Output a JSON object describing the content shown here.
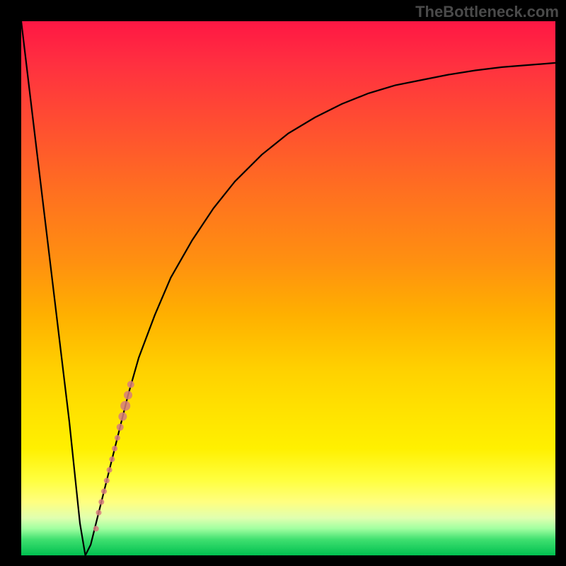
{
  "watermark": "TheBottleneck.com",
  "chart_data": {
    "type": "line",
    "title": "",
    "xlabel": "",
    "ylabel": "",
    "xlim": [
      0,
      100
    ],
    "ylim": [
      0,
      100
    ],
    "description": "Bottleneck percentage curve over a red-to-green heat gradient background. The curve descends steeply from top-left to a minimum near x≈12 (≈0% bottleneck) then rises asymptotically toward ≈92% on the right.",
    "series": [
      {
        "name": "bottleneck-curve",
        "x": [
          0,
          3,
          6,
          9,
          11,
          12,
          13,
          14,
          16,
          18,
          20,
          22,
          25,
          28,
          32,
          36,
          40,
          45,
          50,
          55,
          60,
          65,
          70,
          75,
          80,
          85,
          90,
          95,
          100
        ],
        "y": [
          100,
          75,
          50,
          25,
          6,
          0,
          2,
          6,
          14,
          22,
          30,
          37,
          45,
          52,
          59,
          65,
          70,
          75,
          79,
          82,
          84.5,
          86.5,
          88,
          89,
          90,
          90.8,
          91.4,
          91.8,
          92.2
        ]
      }
    ],
    "dots": {
      "name": "highlighted-range",
      "points": [
        {
          "x": 14.0,
          "y": 5
        },
        {
          "x": 14.5,
          "y": 8
        },
        {
          "x": 15.0,
          "y": 10
        },
        {
          "x": 15.5,
          "y": 12
        },
        {
          "x": 16.0,
          "y": 14
        },
        {
          "x": 16.5,
          "y": 16
        },
        {
          "x": 17.0,
          "y": 18
        },
        {
          "x": 17.5,
          "y": 20
        },
        {
          "x": 18.0,
          "y": 22
        },
        {
          "x": 18.5,
          "y": 24
        },
        {
          "x": 19.0,
          "y": 26
        },
        {
          "x": 19.5,
          "y": 28
        },
        {
          "x": 20.0,
          "y": 30
        },
        {
          "x": 20.5,
          "y": 32
        }
      ]
    },
    "gradient_stops": [
      {
        "pct": 0,
        "color": "#ff1744"
      },
      {
        "pct": 50,
        "color": "#ffb000"
      },
      {
        "pct": 85,
        "color": "#ffff00"
      },
      {
        "pct": 100,
        "color": "#00c050"
      }
    ]
  }
}
